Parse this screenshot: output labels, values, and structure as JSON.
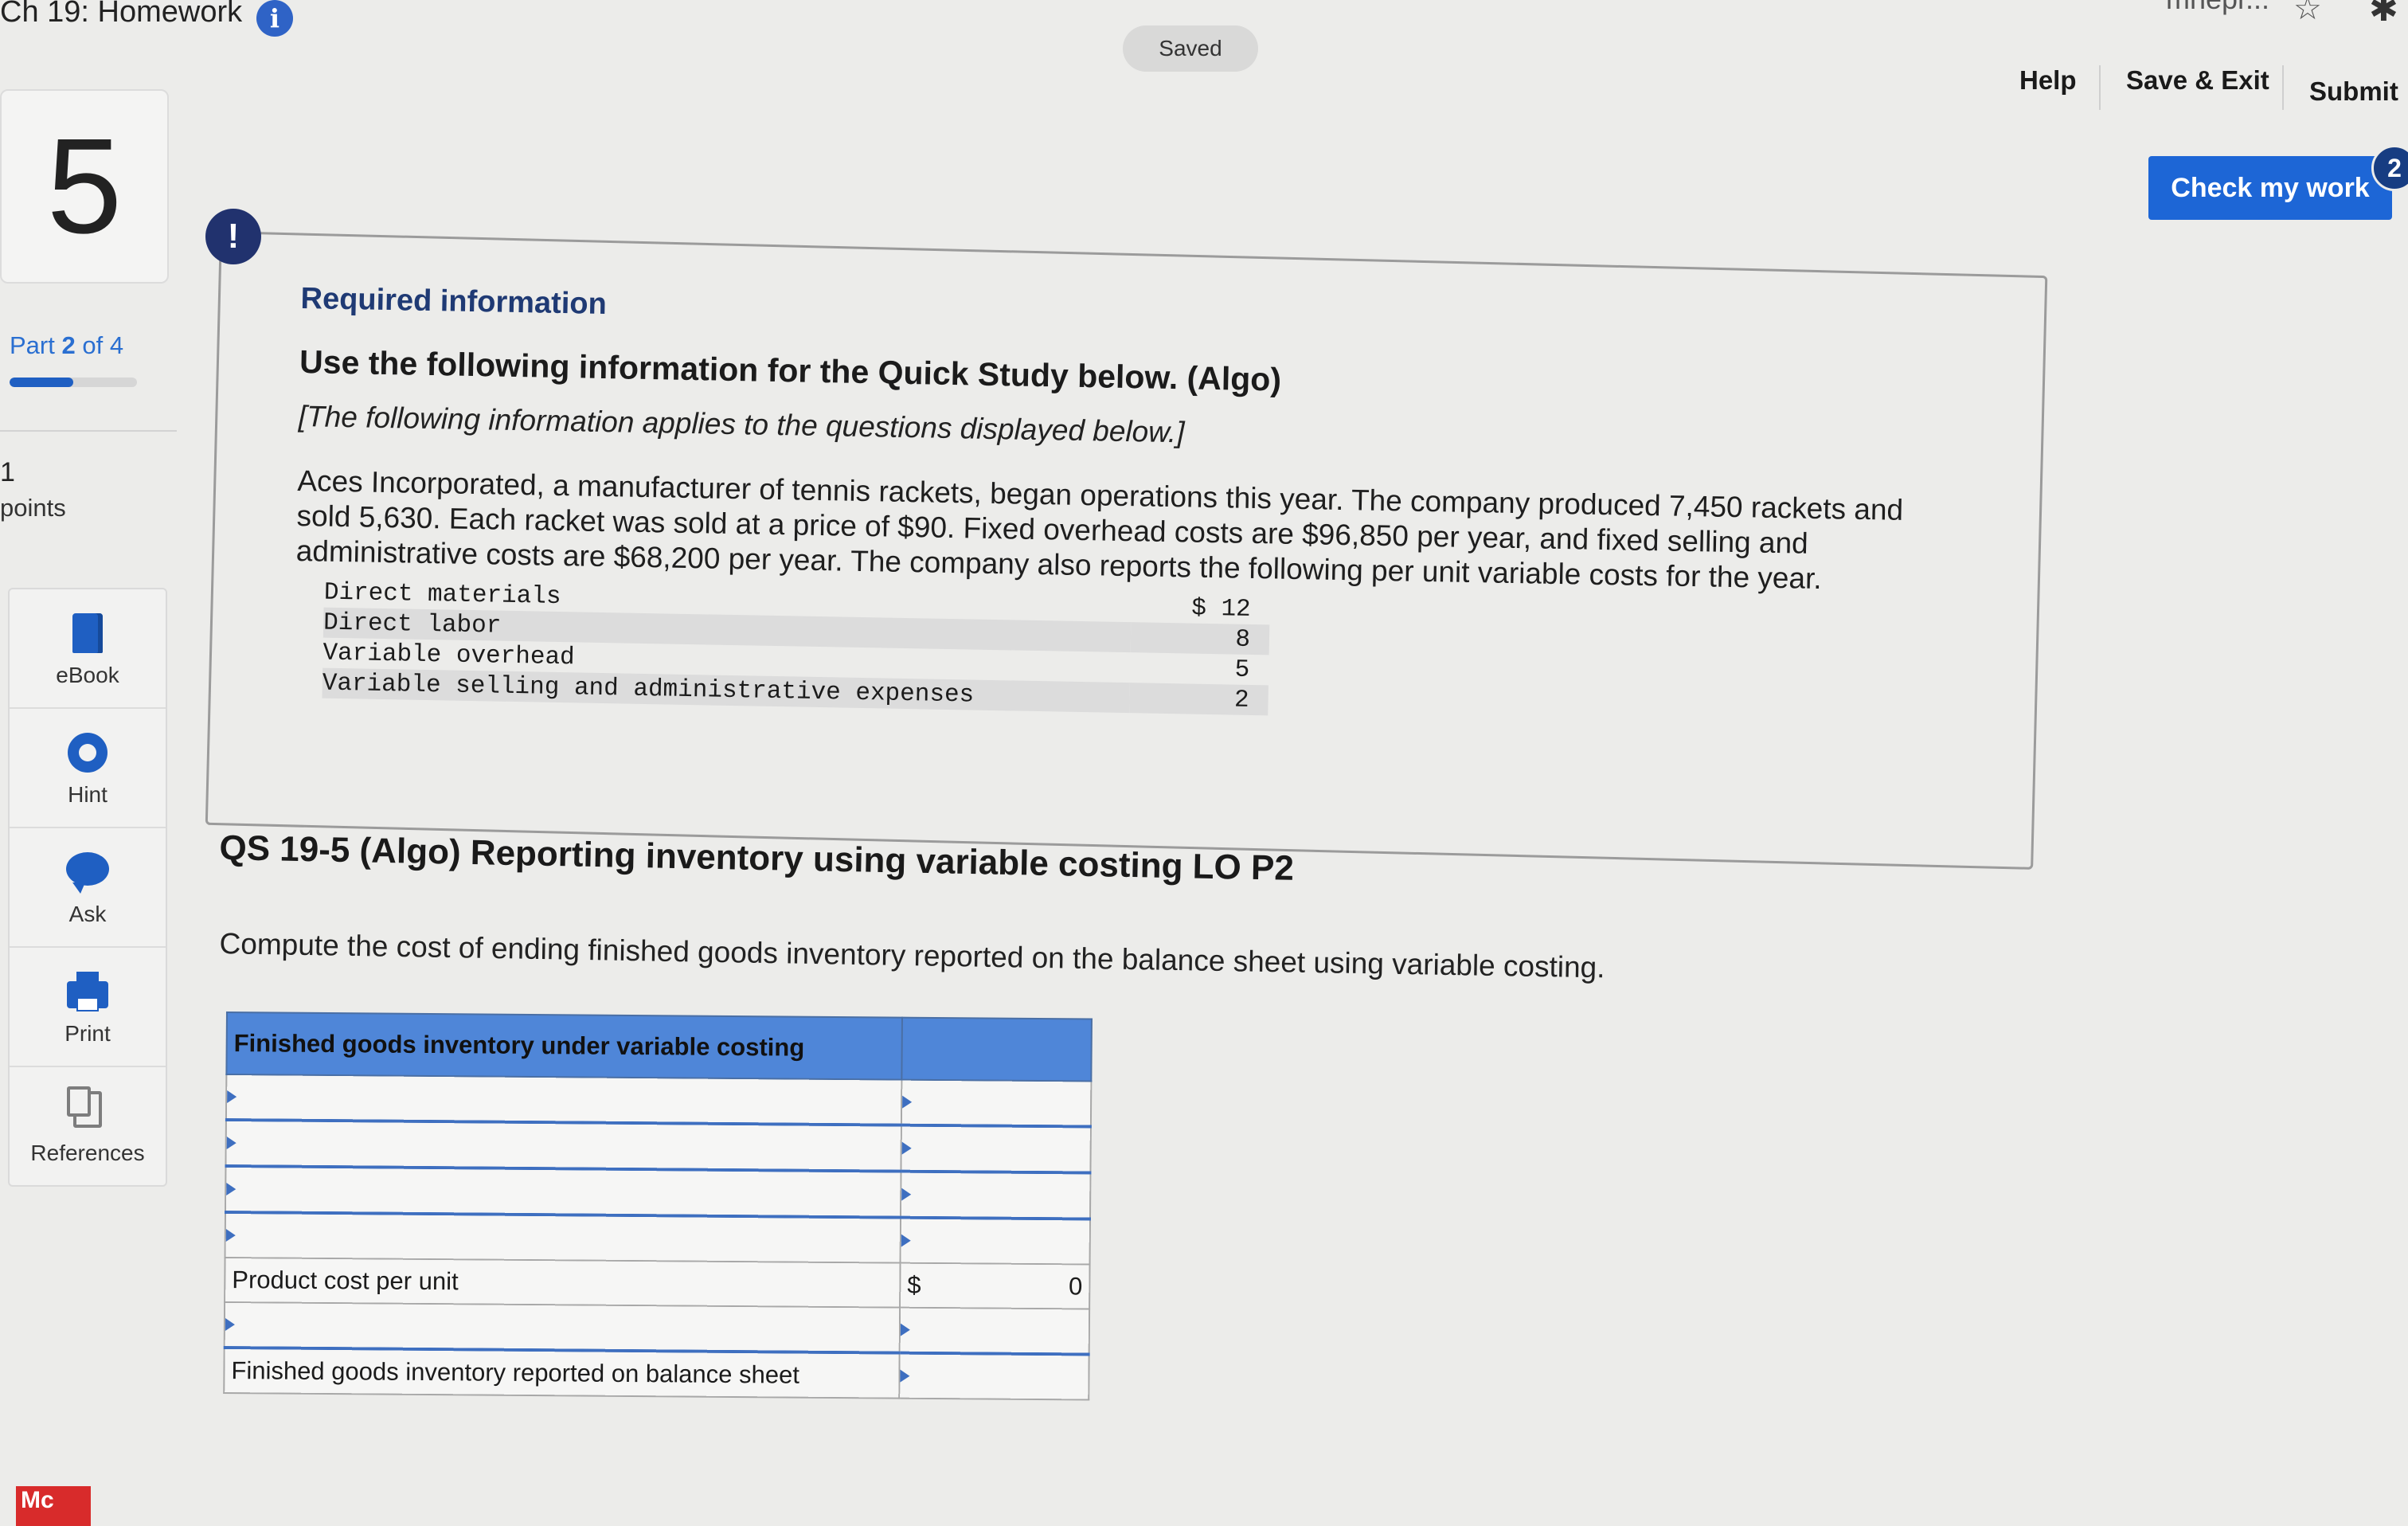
{
  "topbar": {
    "title": "Ch 19: Homework",
    "saved_label": "Saved",
    "tab_title_fragment": "mhepr...",
    "help_label": "Help",
    "save_exit_label": "Save & Exit",
    "submit_label": "Submit",
    "check_label": "Check my work",
    "check_badge": "2"
  },
  "rail": {
    "question_number": "5",
    "part_word": "Part",
    "part_current": "2",
    "part_of": "of 4",
    "part_progress_fraction": 0.5,
    "points_value": "1",
    "points_label": "points",
    "tools": [
      {
        "label": "eBook",
        "icon": "ebook-icon"
      },
      {
        "label": "Hint",
        "icon": "hint-icon"
      },
      {
        "label": "Ask",
        "icon": "ask-icon"
      },
      {
        "label": "Print",
        "icon": "print-icon"
      },
      {
        "label": "References",
        "icon": "references-icon"
      }
    ],
    "logo_text": "Mc"
  },
  "required": {
    "alert_glyph": "!",
    "heading": "Required information",
    "subheading": "Use the following information for the Quick Study below. (Algo)",
    "note": "[The following information applies to the questions displayed below.]",
    "paragraph": "Aces Incorporated, a manufacturer of tennis rackets, began operations this year. The company produced 7,450 rackets and sold 5,630. Each racket was sold at a price of $90. Fixed overhead costs are $96,850 per year, and fixed selling and administrative costs are $68,200 per year. The company also reports the following per unit variable costs for the year.",
    "costs": [
      {
        "label": "Direct materials",
        "amount": "$ 12"
      },
      {
        "label": "Direct labor",
        "amount": "8"
      },
      {
        "label": "Variable overhead",
        "amount": "5"
      },
      {
        "label": "Variable selling and administrative expenses",
        "amount": "2"
      }
    ]
  },
  "question": {
    "title": "QS 19-5 (Algo) Reporting inventory using variable costing LO P2",
    "instruction": "Compute the cost of ending finished goods inventory reported on the balance sheet using variable costing.",
    "table": {
      "header": "Finished goods inventory under variable costing",
      "product_cost_label": "Product cost per unit",
      "product_cost_currency": "$",
      "product_cost_value": "0",
      "fg_label": "Finished goods inventory reported on balance sheet"
    }
  },
  "colors": {
    "accent_blue": "#1d66d6",
    "header_blue": "#4f86d8",
    "alert_navy": "#21326e"
  }
}
